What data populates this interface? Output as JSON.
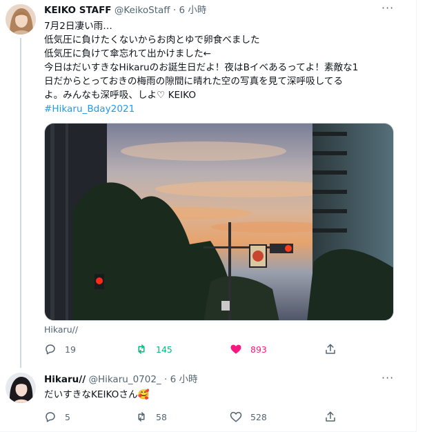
{
  "main_tweet": {
    "author_name": "KEIKO STAFF",
    "handle": "@KeikoStaff",
    "separator": "·",
    "time": "6 小時",
    "text_lines": [
      "7月2日凄い雨…",
      "低気圧に負けたくないからお肉とゆで卵食べました",
      "低気圧に負けて傘忘れて出かけました←",
      "今日はだいすきなHikaruのお誕生日だよ！夜はBイベあるってよ！素敵な1",
      "日だからとっておきの梅雨の隙間に晴れた空の写真を見て深呼吸してる",
      "よ。みんなも深呼吸、しよ♡ KEIKO"
    ],
    "hashtag": "#Hikaru_Bday2021",
    "photo_caption": "Hikaru//",
    "actions": {
      "reply_count": "19",
      "retweet_count": "145",
      "like_count": "893"
    }
  },
  "reply_tweet": {
    "author_name": "Hikaru//",
    "handle": "@Hikaru_0702_",
    "separator": "·",
    "time": "6 小時",
    "text": "だいすきなKEIKOさん🥰",
    "actions": {
      "reply_count": "5",
      "retweet_count": "58",
      "like_count": "528"
    }
  },
  "colors": {
    "retweet_active": "#00ba7c",
    "like_active": "#f91880",
    "link": "#1d9bf0",
    "muted": "#536471"
  },
  "icons": {
    "more": "more-horizontal-icon",
    "reply": "reply-icon",
    "retweet": "retweet-icon",
    "like": "heart-icon",
    "share": "share-icon"
  }
}
